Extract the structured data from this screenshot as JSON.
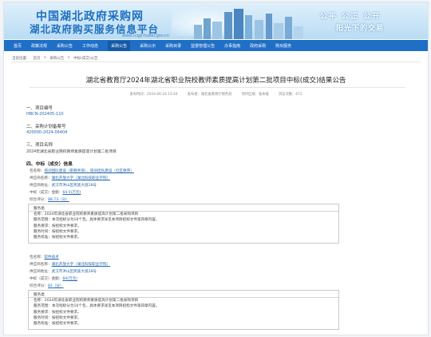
{
  "banner": {
    "title_line1": "中国湖北政府采购网",
    "title_line2": "湖北政府购买服务信息平台",
    "url": "www.ccgp-hubei.gov.cn",
    "slogan_line1": "公平  公正  公开",
    "slogan_line2": "阳光下的交易"
  },
  "nav": {
    "items": [
      {
        "label": "首页"
      },
      {
        "label": "政策法规"
      },
      {
        "label": "采购公告"
      },
      {
        "label": "工作动态"
      },
      {
        "label": "采购公告"
      },
      {
        "label": "采购公示"
      },
      {
        "label": "采购目录"
      },
      {
        "label": "监督管理公告"
      },
      {
        "label": "办事指南"
      },
      {
        "label": "政府采购"
      },
      {
        "label": "购买服务"
      }
    ]
  },
  "breadcrumb": {
    "prefix": "当前位置：",
    "items": [
      "首页",
      "采购公告",
      "中标(成交)公告"
    ],
    "separator": ">"
  },
  "notice": {
    "title": "湖北省教育厅2024年湖北省职业院校教师素质提高计划第二批项目中标(成交)结果公告",
    "meta_date": "发布时间：2024-06-24 15:44",
    "meta_publisher": "发布者：湖北省教育厅财务处",
    "meta_region": "项目区域：省本级",
    "meta_views": "浏览次数：672"
  },
  "sections": {
    "s1_head": "一、项目编号",
    "s1_value": "HBCN-202405-110",
    "s2_head": "二、采购计划备案号",
    "s2_value": "420000-2024-06404",
    "s3_head": "三、项目名称",
    "s3_value": "2024年湖北省职业院校教师素质提高计划第二批项目",
    "s4_head": "四、中标（成交）信息"
  },
  "award1": {
    "package_k": "包名称：",
    "package_v": "培训团队建设（职教师资）、培训团队建设（社区教育）",
    "supplier_k": "供应商名称：",
    "supplier_v": "湖北开放大学（湖北科技职业学院）",
    "address_k": "供应商地址：",
    "address_v": "武汉市洪山区民族大道28号",
    "amount_k": "中标（成交）金额：",
    "amount_v": "64.5(万元)",
    "score_k": "综合评分：",
    "score_v": "88.73（分）",
    "box_head": "服务类",
    "lines": [
      "名称：2024年湖北省职业院校教师素质提高计划第二批采购项目",
      "服务范围：本次招标分为16个包。具体要求详见本项目招标文件第四章内容。",
      "服务要求：按招标文件要求。",
      "服务时间：按招标文件要求。",
      "服务标准：按招标文件要求。"
    ]
  },
  "award2": {
    "package_k": "包名称：",
    "package_v": "软件技术",
    "supplier_k": "供应商名称：",
    "supplier_v": "湖北开放大学（湖北科技职业学院）",
    "address_k": "供应商地址：",
    "address_v": "武汉市洪山区民族大道28号",
    "amount_k": "中标（成交）金额：",
    "amount_v": "84(万元)",
    "score_k": "综合评分：",
    "score_v": "82（分）",
    "box_head": "服务类",
    "lines": [
      "名称：2024年湖北省职业院校教师素质提高计划第二批采购项目",
      "服务范围：本次招标分为16个包，具体要求详见本项目招标文件第四章内容。",
      "服务要求：按招标文件要求。",
      "服务时间：按招标文件要求。",
      "服务标准：按招标文件要求。"
    ]
  },
  "colors": {
    "nav_bg": "#1f6fc6",
    "link": "#2468b0",
    "banner_title": "#1e6fc0"
  }
}
